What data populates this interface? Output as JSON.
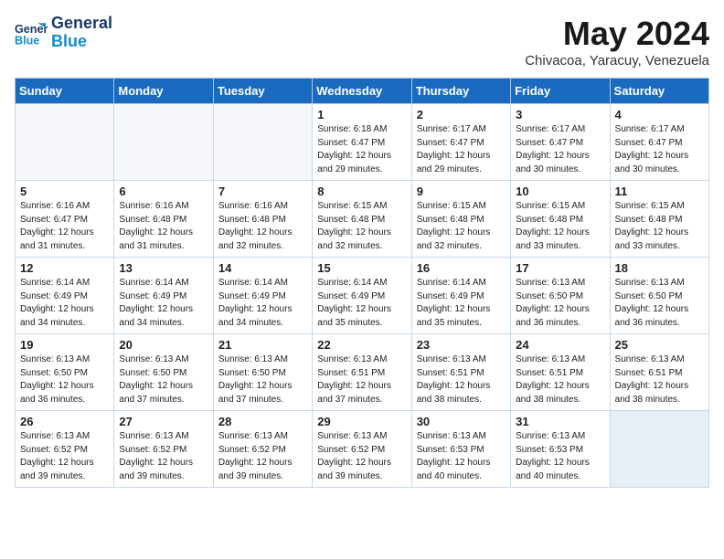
{
  "logo": {
    "line1": "General",
    "line2": "Blue"
  },
  "title": "May 2024",
  "subtitle": "Chivacoa, Yaracuy, Venezuela",
  "days_of_week": [
    "Sunday",
    "Monday",
    "Tuesday",
    "Wednesday",
    "Thursday",
    "Friday",
    "Saturday"
  ],
  "weeks": [
    [
      {
        "num": "",
        "info": ""
      },
      {
        "num": "",
        "info": ""
      },
      {
        "num": "",
        "info": ""
      },
      {
        "num": "1",
        "info": "Sunrise: 6:18 AM\nSunset: 6:47 PM\nDaylight: 12 hours\nand 29 minutes."
      },
      {
        "num": "2",
        "info": "Sunrise: 6:17 AM\nSunset: 6:47 PM\nDaylight: 12 hours\nand 29 minutes."
      },
      {
        "num": "3",
        "info": "Sunrise: 6:17 AM\nSunset: 6:47 PM\nDaylight: 12 hours\nand 30 minutes."
      },
      {
        "num": "4",
        "info": "Sunrise: 6:17 AM\nSunset: 6:47 PM\nDaylight: 12 hours\nand 30 minutes."
      }
    ],
    [
      {
        "num": "5",
        "info": "Sunrise: 6:16 AM\nSunset: 6:47 PM\nDaylight: 12 hours\nand 31 minutes."
      },
      {
        "num": "6",
        "info": "Sunrise: 6:16 AM\nSunset: 6:48 PM\nDaylight: 12 hours\nand 31 minutes."
      },
      {
        "num": "7",
        "info": "Sunrise: 6:16 AM\nSunset: 6:48 PM\nDaylight: 12 hours\nand 32 minutes."
      },
      {
        "num": "8",
        "info": "Sunrise: 6:15 AM\nSunset: 6:48 PM\nDaylight: 12 hours\nand 32 minutes."
      },
      {
        "num": "9",
        "info": "Sunrise: 6:15 AM\nSunset: 6:48 PM\nDaylight: 12 hours\nand 32 minutes."
      },
      {
        "num": "10",
        "info": "Sunrise: 6:15 AM\nSunset: 6:48 PM\nDaylight: 12 hours\nand 33 minutes."
      },
      {
        "num": "11",
        "info": "Sunrise: 6:15 AM\nSunset: 6:48 PM\nDaylight: 12 hours\nand 33 minutes."
      }
    ],
    [
      {
        "num": "12",
        "info": "Sunrise: 6:14 AM\nSunset: 6:49 PM\nDaylight: 12 hours\nand 34 minutes."
      },
      {
        "num": "13",
        "info": "Sunrise: 6:14 AM\nSunset: 6:49 PM\nDaylight: 12 hours\nand 34 minutes."
      },
      {
        "num": "14",
        "info": "Sunrise: 6:14 AM\nSunset: 6:49 PM\nDaylight: 12 hours\nand 34 minutes."
      },
      {
        "num": "15",
        "info": "Sunrise: 6:14 AM\nSunset: 6:49 PM\nDaylight: 12 hours\nand 35 minutes."
      },
      {
        "num": "16",
        "info": "Sunrise: 6:14 AM\nSunset: 6:49 PM\nDaylight: 12 hours\nand 35 minutes."
      },
      {
        "num": "17",
        "info": "Sunrise: 6:13 AM\nSunset: 6:50 PM\nDaylight: 12 hours\nand 36 minutes."
      },
      {
        "num": "18",
        "info": "Sunrise: 6:13 AM\nSunset: 6:50 PM\nDaylight: 12 hours\nand 36 minutes."
      }
    ],
    [
      {
        "num": "19",
        "info": "Sunrise: 6:13 AM\nSunset: 6:50 PM\nDaylight: 12 hours\nand 36 minutes."
      },
      {
        "num": "20",
        "info": "Sunrise: 6:13 AM\nSunset: 6:50 PM\nDaylight: 12 hours\nand 37 minutes."
      },
      {
        "num": "21",
        "info": "Sunrise: 6:13 AM\nSunset: 6:50 PM\nDaylight: 12 hours\nand 37 minutes."
      },
      {
        "num": "22",
        "info": "Sunrise: 6:13 AM\nSunset: 6:51 PM\nDaylight: 12 hours\nand 37 minutes."
      },
      {
        "num": "23",
        "info": "Sunrise: 6:13 AM\nSunset: 6:51 PM\nDaylight: 12 hours\nand 38 minutes."
      },
      {
        "num": "24",
        "info": "Sunrise: 6:13 AM\nSunset: 6:51 PM\nDaylight: 12 hours\nand 38 minutes."
      },
      {
        "num": "25",
        "info": "Sunrise: 6:13 AM\nSunset: 6:51 PM\nDaylight: 12 hours\nand 38 minutes."
      }
    ],
    [
      {
        "num": "26",
        "info": "Sunrise: 6:13 AM\nSunset: 6:52 PM\nDaylight: 12 hours\nand 39 minutes."
      },
      {
        "num": "27",
        "info": "Sunrise: 6:13 AM\nSunset: 6:52 PM\nDaylight: 12 hours\nand 39 minutes."
      },
      {
        "num": "28",
        "info": "Sunrise: 6:13 AM\nSunset: 6:52 PM\nDaylight: 12 hours\nand 39 minutes."
      },
      {
        "num": "29",
        "info": "Sunrise: 6:13 AM\nSunset: 6:52 PM\nDaylight: 12 hours\nand 39 minutes."
      },
      {
        "num": "30",
        "info": "Sunrise: 6:13 AM\nSunset: 6:53 PM\nDaylight: 12 hours\nand 40 minutes."
      },
      {
        "num": "31",
        "info": "Sunrise: 6:13 AM\nSunset: 6:53 PM\nDaylight: 12 hours\nand 40 minutes."
      },
      {
        "num": "",
        "info": ""
      }
    ]
  ]
}
